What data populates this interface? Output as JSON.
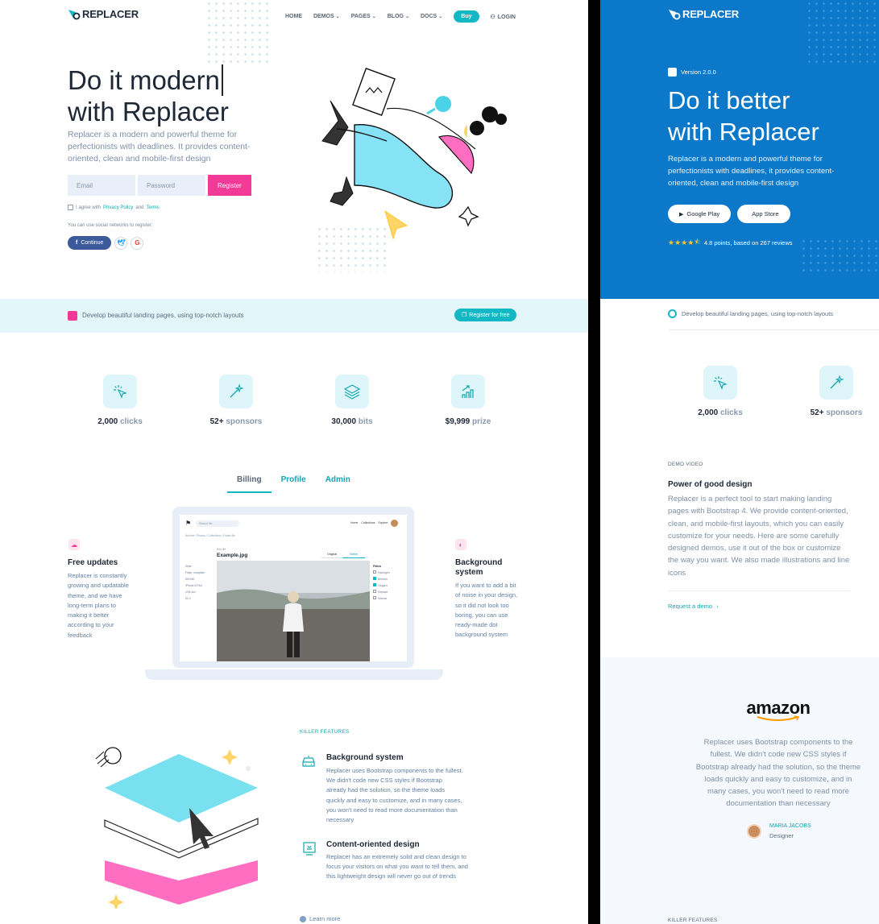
{
  "brand": {
    "name": "REPLACER",
    "accent": "#14b8c4",
    "pink": "#f23a96",
    "blue": "#0c78c9"
  },
  "nav": {
    "items": [
      {
        "label": "HOME"
      },
      {
        "label": "DEMOS"
      },
      {
        "label": "PAGES"
      },
      {
        "label": "BLOG"
      },
      {
        "label": "DOCS"
      }
    ],
    "buy_label": "Buy",
    "login_label": "LOGIN"
  },
  "hero": {
    "title_line1": "Do it modern",
    "title_line2": "with Replacer",
    "subtitle": "Replacer is a modern and powerful theme for perfectionists with deadlines. It provides content-oriented, clean and mobile-first design",
    "email_placeholder": "Email",
    "password_placeholder": "Password",
    "register_label": "Register",
    "agree_prefix": "I agree with",
    "privacy_label": "Privacy Policy",
    "and_label": "and",
    "terms_label": "Terms",
    "social_hint": "You can use social networks to register:",
    "continue_label": "Continue"
  },
  "banner": {
    "text": "Develop beautiful landing pages, using top-notch layouts",
    "cta": "Register for free"
  },
  "stats": [
    {
      "value": "2,000",
      "unit": "clicks",
      "icon": "cursor-click-icon"
    },
    {
      "value": "52+",
      "unit": "sponsors",
      "icon": "magic-wand-icon"
    },
    {
      "value": "30,000",
      "unit": "bits",
      "icon": "layers-icon"
    },
    {
      "value": "$9,999",
      "unit": "prize",
      "icon": "growth-chart-icon"
    }
  ],
  "tabs": [
    {
      "label": "Billing"
    },
    {
      "label": "Profile"
    },
    {
      "label": "Admin"
    }
  ],
  "features_left": {
    "title": "Free updates",
    "text": "Replacer is constantly growing and updatable theme, and we have long-term plans to making it better according to your feedback"
  },
  "features_right": {
    "title_line1": "Background",
    "title_line2": "system",
    "text": "If you want to add a bit of noise in your design, so it did not look too boring, you can use ready-made dot background system"
  },
  "mock_app": {
    "search": "Search file",
    "nav": [
      "Home",
      "Collections",
      "Explore"
    ],
    "breadcrumb": "Archive / Photos / Collections / Folder file",
    "file_label": "Edit file",
    "file_name": "Example.jpg",
    "toggle": [
      "Original",
      "Edited"
    ],
    "filters_title": "Filters",
    "filters": [
      "Hydrogen",
      "Bentum",
      "Oxygen",
      "Replace",
      "Normal"
    ],
    "meta": [
      "Style",
      "Flash, computer",
      "800×60",
      "iPhone 8 Plus",
      "1/30 sec",
      "f/2.2"
    ]
  },
  "killer": {
    "label": "KILLER FEATURES",
    "items": [
      {
        "title": "Background system",
        "text": "Replacer uses Bootstrap components to the fullest. We didn't code new CSS styles if Bootstrap already had the solution, so the theme loads quickly and easy to customize, and in many cases, you won't need to read more documentation than necessary"
      },
      {
        "title": "Content-oriented design",
        "text": "Replacer has an extremely solid and clean design to focus your visitors on what you want to tell them, and this lightweight design will never go out of trends"
      }
    ],
    "learn_more": "Learn more"
  },
  "mobile": {
    "version": "Version 2.0.0",
    "title_line1": "Do it better",
    "title_line2": "with Replacer",
    "subtitle": "Replacer is a modern and powerful theme for perfectionists with deadlines, it provides content-oriented, clean and mobile-first design",
    "google_play": "Google Play",
    "app_store": "App Store",
    "rating_text": "4.8 points, based on 267 reviews",
    "rating": 4.8,
    "banner_text": "Develop beautiful landing pages, using top-notch layouts",
    "demo_label": "DEMO VIDEO",
    "demo_title": "Power of good design",
    "demo_text": "Replacer is a perfect tool to start making landing pages with Bootstrap 4. We provide content-oriented, clean, and mobile-first layouts, which you can easily customize for your needs. Here are some carefully designed demos, use it out of the box or customize the way you want. We also made illustrations and line icons",
    "request_demo": "Request a demo",
    "quote_brand": "amazon",
    "quote_text": "Replacer uses Bootstrap components to the fullest. We didn't code new CSS styles if Bootstrap already had the solution, so the theme loads quickly and easy to customize, and in many cases, you won't need to read more documentation than necessary",
    "author_name": "MARIA JACOBS",
    "author_role": "Designer",
    "killer_label": "KILLER FEATURES"
  }
}
